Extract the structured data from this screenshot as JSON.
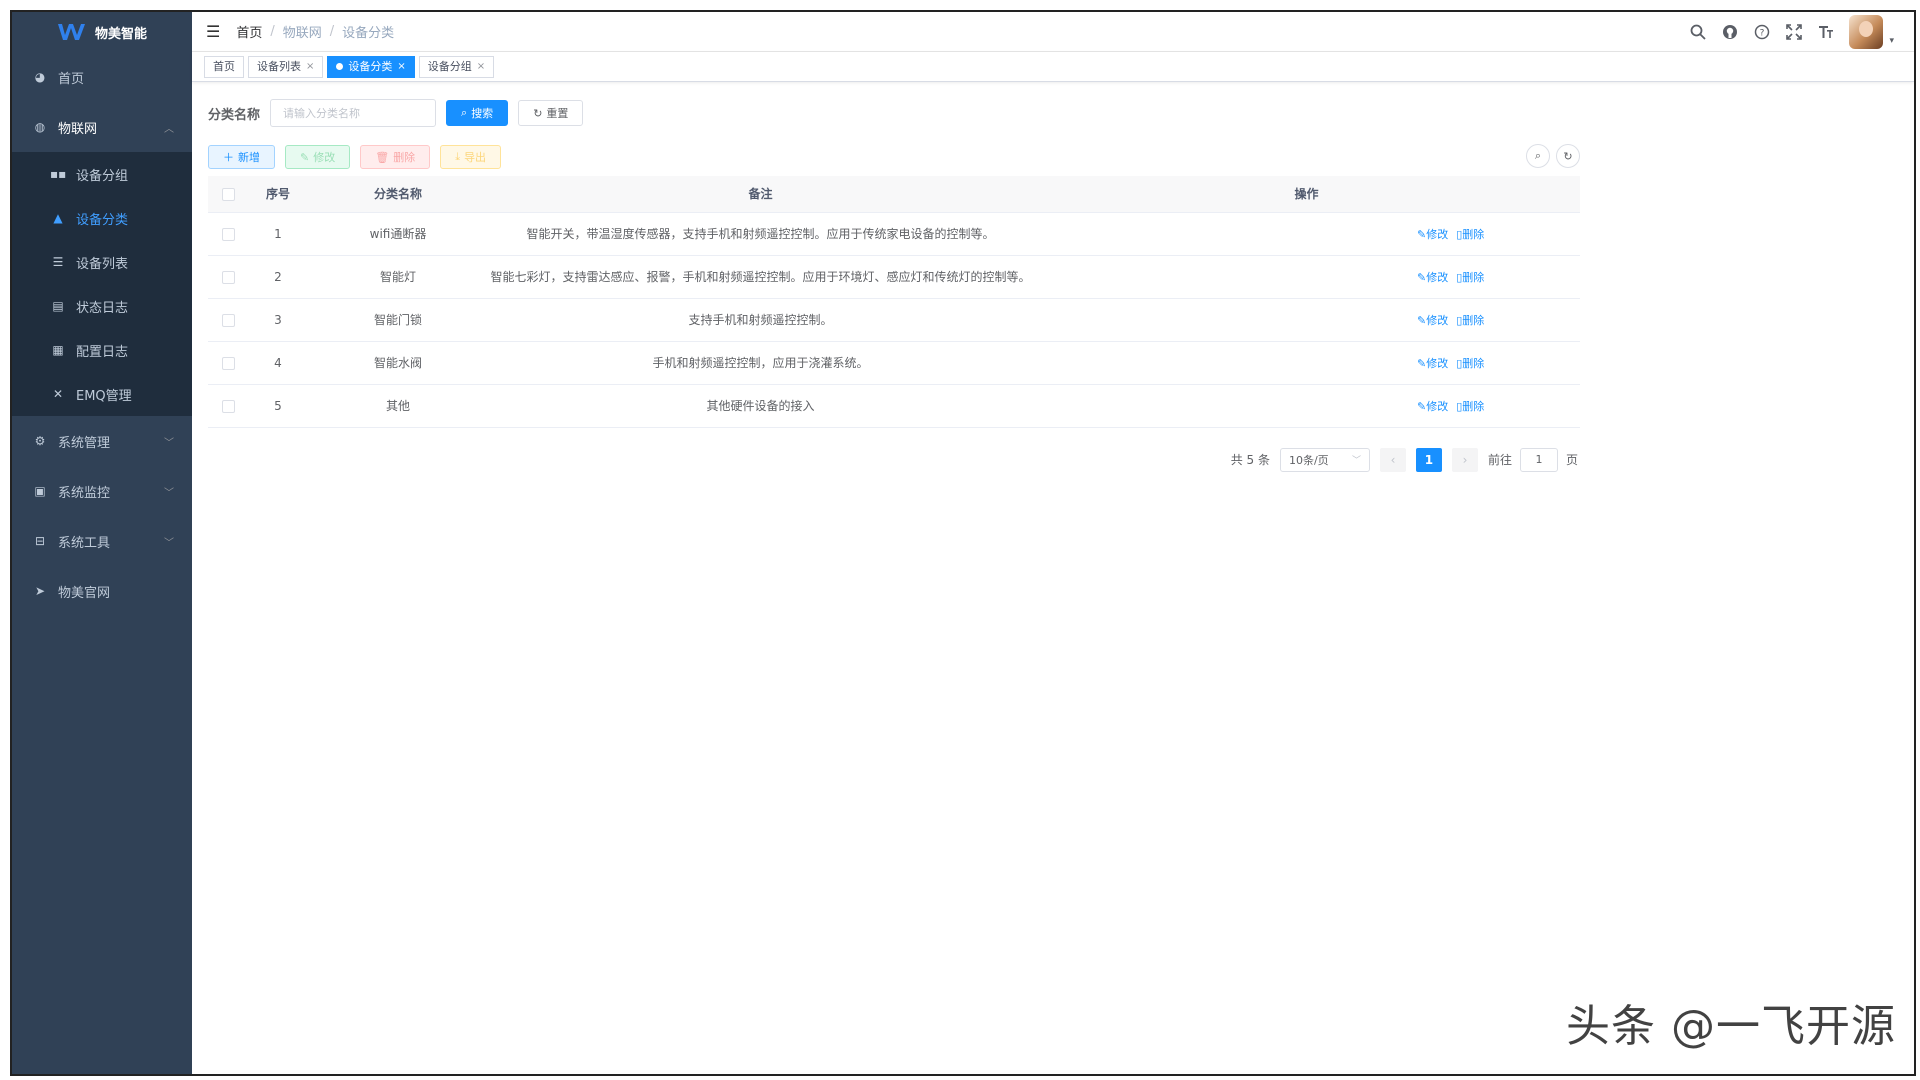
{
  "app": {
    "logo_text": "物美智能"
  },
  "sidebar": {
    "items": [
      {
        "label": "首页",
        "icon": "dashboard-icon"
      },
      {
        "label": "物联网",
        "icon": "iot-icon"
      }
    ],
    "iot_children": [
      {
        "label": "设备分组",
        "icon": "grid-icon"
      },
      {
        "label": "设备分类",
        "icon": "category-icon"
      },
      {
        "label": "设备列表",
        "icon": "list-icon"
      },
      {
        "label": "状态日志",
        "icon": "log-icon"
      },
      {
        "label": "配置日志",
        "icon": "config-log-icon"
      },
      {
        "label": "EMQ管理",
        "icon": "tool-icon"
      }
    ],
    "bottom_items": [
      {
        "label": "系统管理",
        "icon": "settings-icon"
      },
      {
        "label": "系统监控",
        "icon": "monitor-icon"
      },
      {
        "label": "系统工具",
        "icon": "toolbox-icon"
      },
      {
        "label": "物美官网",
        "icon": "send-icon"
      }
    ],
    "active_item": "设备分类"
  },
  "navbar": {
    "breadcrumb": [
      "首页",
      "物联网",
      "设备分类"
    ]
  },
  "tags": [
    {
      "label": "首页"
    },
    {
      "label": "设备列表"
    },
    {
      "label": "设备分类"
    },
    {
      "label": "设备分组"
    }
  ],
  "search": {
    "label": "分类名称",
    "placeholder": "请输入分类名称",
    "value": "",
    "search_button": "搜索",
    "reset_button": "重置"
  },
  "toolbar": {
    "add": "新增",
    "edit": "修改",
    "delete": "删除",
    "export": "导出"
  },
  "table": {
    "columns": [
      "序号",
      "分类名称",
      "备注",
      "操作"
    ],
    "rows": [
      {
        "id": "1",
        "name": "wifi通断器",
        "remark": "智能开关，带温湿度传感器，支持手机和射频遥控控制。应用于传统家电设备的控制等。"
      },
      {
        "id": "2",
        "name": "智能灯",
        "remark": "智能七彩灯，支持雷达感应、报警，手机和射频遥控控制。应用于环境灯、感应灯和传统灯的控制等。"
      },
      {
        "id": "3",
        "name": "智能门锁",
        "remark": "支持手机和射频遥控控制。"
      },
      {
        "id": "4",
        "name": "智能水阀",
        "remark": "手机和射频遥控控制，应用于浇灌系统。"
      },
      {
        "id": "5",
        "name": "其他",
        "remark": "其他硬件设备的接入"
      }
    ],
    "row_actions": {
      "edit": "修改",
      "delete": "删除"
    }
  },
  "pagination": {
    "total_text": "共 5 条",
    "page_size": "10条/页",
    "current_page": "1",
    "goto_prefix": "前往",
    "goto_value": "1",
    "goto_suffix": "页"
  },
  "watermark": "头条 @一飞开源",
  "colors": {
    "sidebar_bg": "#304156",
    "submenu_bg": "#1f2d3d",
    "primary": "#1890ff"
  }
}
